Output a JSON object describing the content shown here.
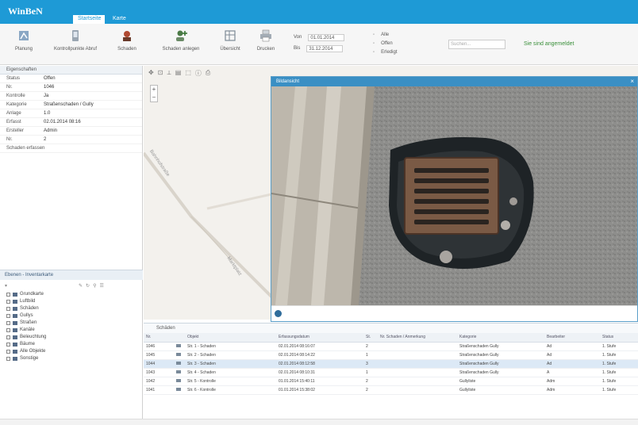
{
  "app": {
    "title": "WinBeN",
    "tabs": [
      "Startseite",
      "Karte"
    ]
  },
  "ribbon": {
    "buttons": [
      {
        "label": "Planung",
        "icon": "map-icon"
      },
      {
        "label": "Kontrollpunkte Abruf",
        "icon": "device-icon"
      },
      {
        "label": "Schaden",
        "icon": "damage-icon"
      },
      {
        "label": "Schaden anlegen",
        "icon": "add-user-icon"
      },
      {
        "label": "Übersicht",
        "icon": "grid-icon"
      },
      {
        "label": "Drucken",
        "icon": "print-icon"
      }
    ],
    "fields": [
      {
        "label": "Von",
        "value": "01.01.2014"
      },
      {
        "label": "Bis",
        "value": "31.12.2014"
      }
    ],
    "options": [
      "Alle",
      "Offen",
      "Erledigt"
    ],
    "search_placeholder": "Suchen...",
    "status": "Sie sind angemeldet"
  },
  "properties": {
    "header": "Eigenschaften",
    "rows": [
      {
        "key": "Status",
        "value": "Offen"
      },
      {
        "key": "Nr.",
        "value": "1046"
      },
      {
        "key": "Kontrolle",
        "value": "Ja"
      },
      {
        "key": "Kategorie",
        "value": "Straßenschaden / Gully"
      },
      {
        "key": "Anlage",
        "value": "1.0"
      },
      {
        "key": "Erfasst",
        "value": "02.01.2014 08:16"
      },
      {
        "key": "Ersteller",
        "value": "Admin"
      },
      {
        "key": "Nr.",
        "value": "2"
      }
    ],
    "footer_label": "Schaden erfassen"
  },
  "layers": {
    "header": "Ebenen - Inventarkarte",
    "items": [
      "Grundkarte",
      "Luftbild",
      "Schäden",
      "Gullys",
      "Straßen",
      "Kanäle",
      "Beleuchtung",
      "Bäume",
      "Alle Objekte",
      "Sonstige"
    ]
  },
  "map": {
    "labels": [
      "Bahnhofstraße",
      "Marktplatz"
    ],
    "zoom_in": "+",
    "zoom_out": "−"
  },
  "image_window": {
    "title": "Bildansicht",
    "close": "×"
  },
  "grid": {
    "title": "Schäden",
    "columns": [
      "Nr.",
      "",
      "Objekt",
      "Erfassungsdatum",
      "St.",
      "Nr. Schaden / Anmerkung",
      "Kategorie",
      "Bearbeiter",
      "Status"
    ],
    "rows": [
      [
        "1046",
        "",
        "Str. 1 - Schaden",
        "02.01.2014 08:16:07",
        "2",
        "",
        "Straßenschaden Gully",
        "Ad",
        "1. Stufe"
      ],
      [
        "1045",
        "",
        "Str. 2 - Schaden",
        "02.01.2014 08:14:22",
        "1",
        "",
        "Straßenschaden Gully",
        "Ad",
        "1. Stufe"
      ],
      [
        "1044",
        "",
        "Str. 3 - Schaden",
        "02.01.2014 08:12:58",
        "3",
        "",
        "Straßenschaden Gully",
        "Ad",
        "1. Stufe"
      ],
      [
        "1043",
        "",
        "Str. 4 - Schaden",
        "02.01.2014 08:10:31",
        "1",
        "",
        "Straßenschaden Gully",
        "A",
        "1. Stufe"
      ],
      [
        "1042",
        "",
        "Str. 5 - Kontrolle",
        "01.01.2014 15:40:11",
        "2",
        "",
        "Gullyliste",
        "Adm",
        "1. Stufe"
      ],
      [
        "1041",
        "",
        "Str. 6 - Kontrolle",
        "01.01.2014 15:38:02",
        "2",
        "",
        "Gullyliste",
        "Adm",
        "1. Stufe"
      ]
    ],
    "selected_row": 2
  }
}
